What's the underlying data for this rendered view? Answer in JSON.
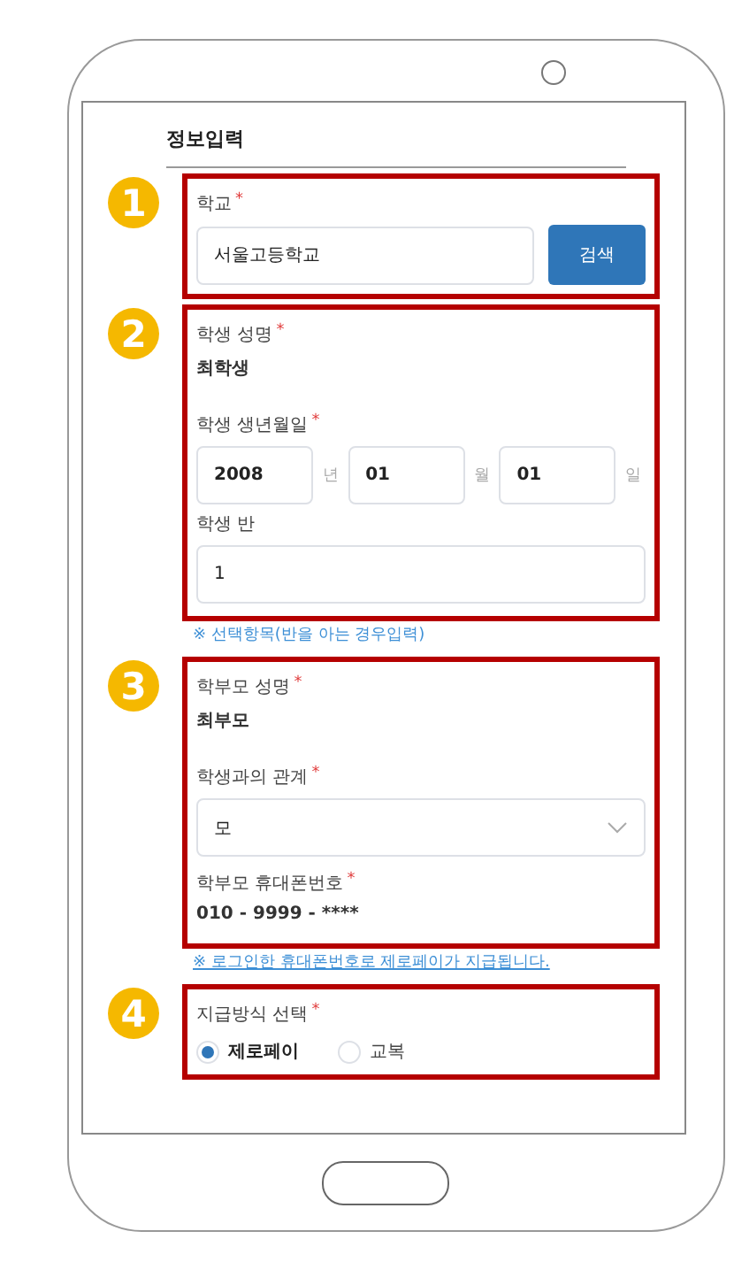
{
  "heading": "정보입력",
  "sections": [
    {
      "number": "1",
      "fields": [
        {
          "kind": "search",
          "label": "학교",
          "mark": "*",
          "value": "서울고등학교",
          "button": "검색"
        }
      ]
    },
    {
      "number": "2",
      "fields": [
        {
          "kind": "text",
          "label": "학생 성명",
          "mark": "*",
          "value": "최학생"
        },
        {
          "kind": "date",
          "label": "학생 생년월일",
          "mark": "*",
          "parts": [
            {
              "value": "2008",
              "unit": "년"
            },
            {
              "value": "01",
              "unit": "월"
            },
            {
              "value": "01",
              "unit": "일"
            }
          ]
        },
        {
          "kind": "input",
          "label": "학생 반",
          "value": "1"
        }
      ],
      "note": {
        "text": "※ 선택항목(반을 아는 경우입력)",
        "underline": false
      }
    },
    {
      "number": "3",
      "fields": [
        {
          "kind": "text",
          "label": "학부모 성명",
          "mark": "*",
          "value": "최부모"
        },
        {
          "kind": "select",
          "label": "학생과의 관계",
          "mark": "*",
          "value": "모"
        },
        {
          "kind": "text",
          "label": "학부모 휴대폰번호",
          "mark": "*",
          "value": "010 - 9999 - ****"
        }
      ],
      "note": {
        "text": "※ 로그인한 휴대폰번호로 제로페이가 지급됩니다.",
        "underline": true
      }
    },
    {
      "number": "4",
      "fields": [
        {
          "kind": "radio",
          "label": "지급방식 선택",
          "mark": "*",
          "options": [
            {
              "label": "제로페이",
              "selected": true
            },
            {
              "label": "교복",
              "selected": false
            }
          ]
        }
      ]
    }
  ]
}
